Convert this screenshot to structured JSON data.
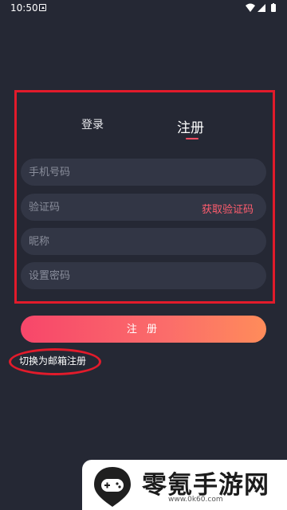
{
  "status_bar": {
    "time": "10:50",
    "icons": [
      "notification-icon",
      "wifi-icon",
      "signal-icon",
      "battery-icon"
    ]
  },
  "tabs": {
    "login_label": "登录",
    "register_label": "注册",
    "active": "register"
  },
  "form": {
    "phone_placeholder": "手机号码",
    "code_placeholder": "验证码",
    "get_code_label": "获取验证码",
    "nickname_placeholder": "昵称",
    "password_placeholder": "设置密码"
  },
  "register_button_label": "注 册",
  "switch_email_label": "切换为邮箱注册",
  "watermark": {
    "title": "零氪手游网",
    "url": "www.0k60.com"
  },
  "colors": {
    "background": "#252834",
    "field": "#323645",
    "accent": "#ff5d6e",
    "button_start": "#f7466a",
    "button_end": "#ff8c5a",
    "annotation_red": "#e21b2b"
  }
}
